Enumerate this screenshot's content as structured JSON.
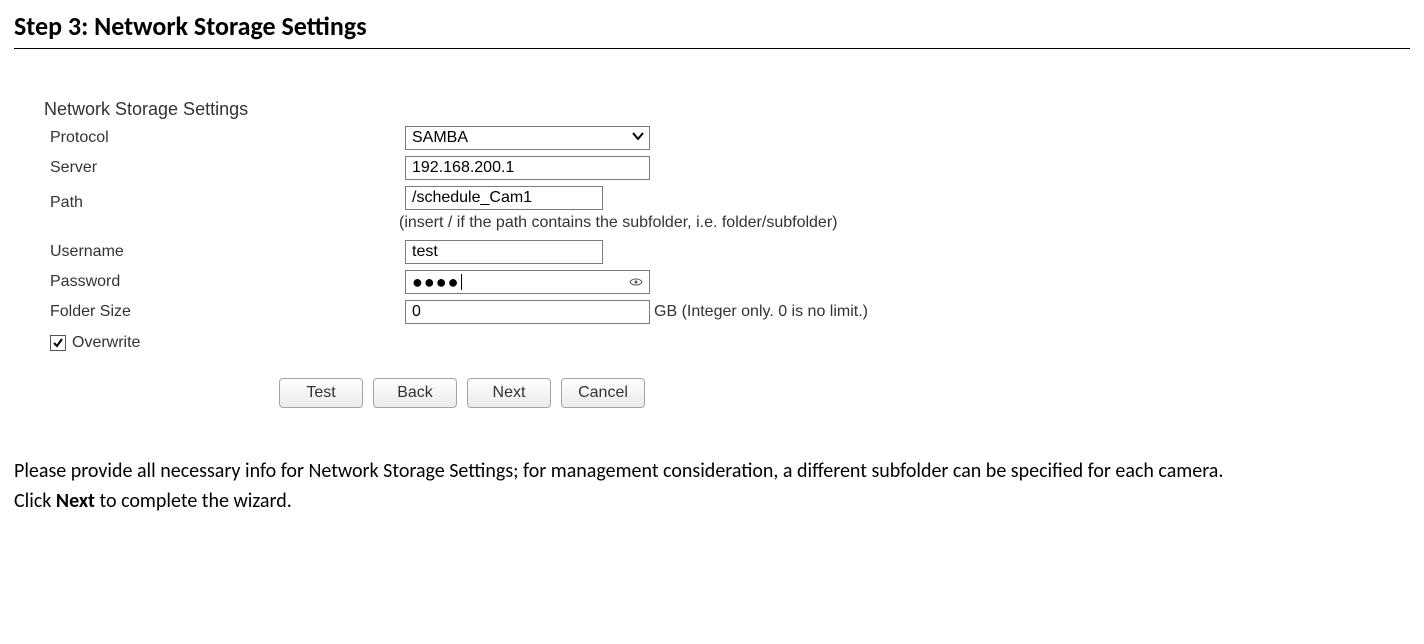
{
  "doc": {
    "step_title": "Step 3: Network Storage Settings",
    "desc_line1": "Please provide all necessary info for Network Storage Settings; for management consideration, a different subfolder can be specified for each camera.",
    "desc_line2_a": "Click ",
    "desc_line2_b": "Next",
    "desc_line2_c": " to complete the wizard."
  },
  "panel": {
    "title": "Network Storage Settings",
    "labels": {
      "protocol": "Protocol",
      "server": "Server",
      "path": "Path",
      "path_hint": "(insert / if the path contains the subfolder, i.e. folder/subfolder)",
      "username": "Username",
      "password": "Password",
      "folder_size": "Folder Size",
      "folder_size_suffix": "GB (Integer only. 0 is no limit.)",
      "overwrite": "Overwrite"
    },
    "values": {
      "protocol_selected": "SAMBA",
      "server": "192.168.200.1",
      "path": "/schedule_Cam1",
      "username": "test",
      "password_dots": "●●●●",
      "folder_size": "0",
      "overwrite_checked": true
    },
    "buttons": {
      "test": "Test",
      "back": "Back",
      "next": "Next",
      "cancel": "Cancel"
    }
  }
}
